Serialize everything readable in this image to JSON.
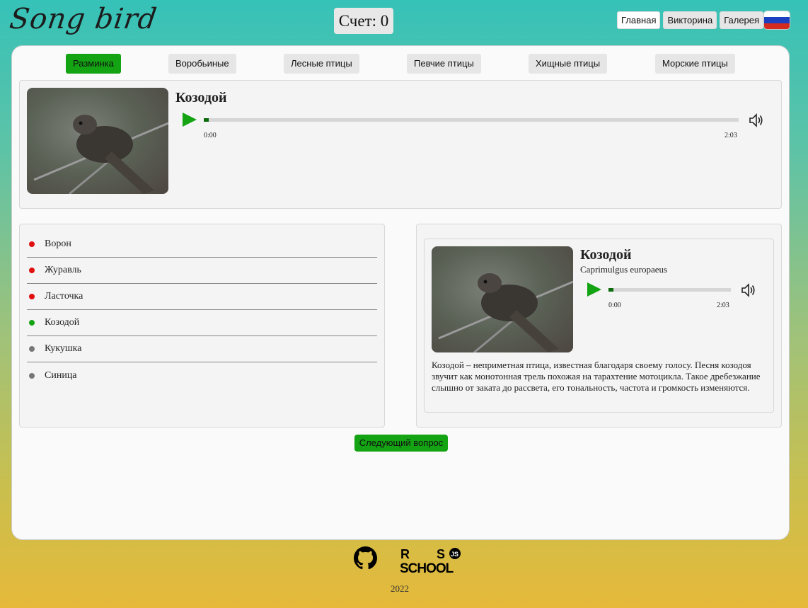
{
  "header": {
    "logo": "Song bird",
    "score_text": "Счет: 0",
    "nav": [
      "Главная",
      "Викторина",
      "Галерея"
    ],
    "flag_colors": [
      "#ffffff",
      "#1c3fbf",
      "#d52b1e"
    ]
  },
  "categories": [
    {
      "label": "Разминка",
      "active": true
    },
    {
      "label": "Воробьиные",
      "active": false
    },
    {
      "label": "Лесные птицы",
      "active": false
    },
    {
      "label": "Певчие птицы",
      "active": false
    },
    {
      "label": "Хищные птицы",
      "active": false
    },
    {
      "label": "Морские птицы",
      "active": false
    }
  ],
  "question": {
    "bird_name": "Козодой",
    "player": {
      "current": "0:00",
      "duration": "2:03",
      "progress": 0.01
    },
    "image_icon": "nightjar-photo"
  },
  "answers": [
    {
      "label": "Ворон",
      "status": "wrong",
      "color": "#e01010"
    },
    {
      "label": "Журавль",
      "status": "wrong",
      "color": "#e01010"
    },
    {
      "label": "Ласточка",
      "status": "wrong",
      "color": "#e01010"
    },
    {
      "label": "Козодой",
      "status": "correct",
      "color": "#13a313"
    },
    {
      "label": "Кукушка",
      "status": "unanswered",
      "color": "#777777"
    },
    {
      "label": "Синица",
      "status": "unanswered",
      "color": "#777777"
    }
  ],
  "details": {
    "name": "Козодой",
    "latin": "Caprimulgus europaeus",
    "player": {
      "current": "0:00",
      "duration": "2:03",
      "progress": 0.01
    },
    "description": "Козодой – неприметная птица, известная благодаря своему голосу. Песня козодоя звучит как монотонная трель похожая на тарахтение мотоцикла. Такое дребезжание слышно от заката до рассвета, его тональность, частота и громкость изменяются."
  },
  "next_button": "Следующий вопрос",
  "footer": {
    "year": "2022",
    "github_icon": "github-icon",
    "rs_logo": "RS SCHOOL JS"
  },
  "colors": {
    "accent": "#13a313",
    "wrong": "#e01010",
    "neutral": "#777777"
  }
}
